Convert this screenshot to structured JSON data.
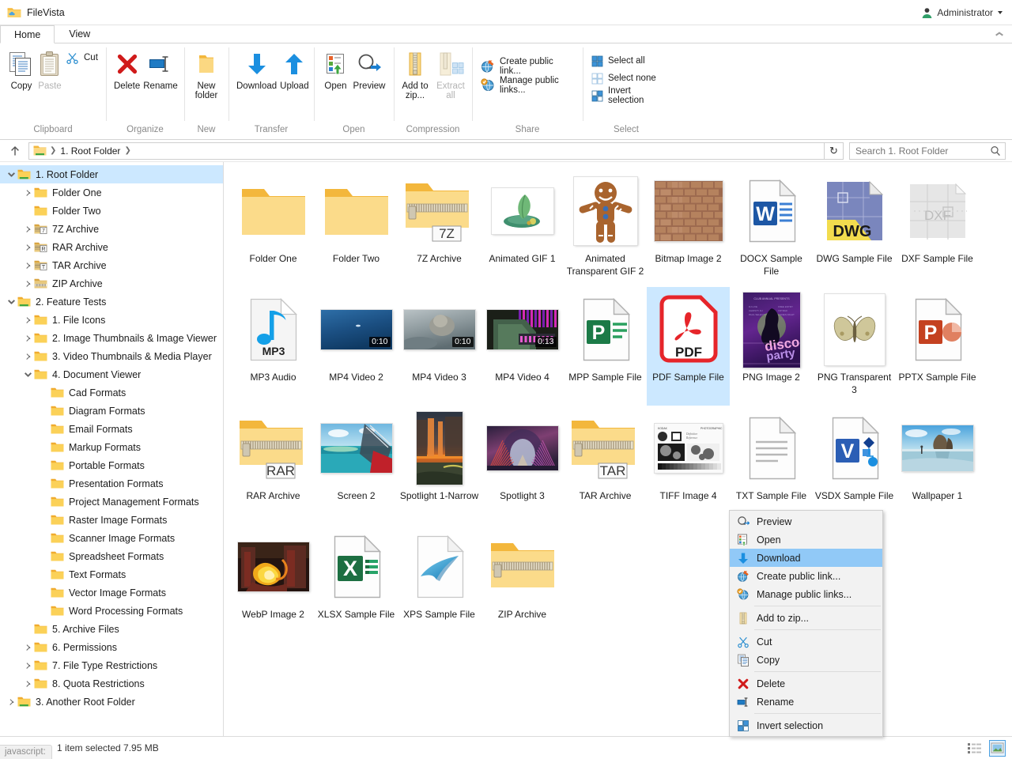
{
  "app": {
    "title": "FileVista",
    "user": "Administrator",
    "user_icon": "avatar-icon",
    "logo_icon": "folder-cloud-icon"
  },
  "tabs": [
    {
      "label": "Home",
      "active": true
    },
    {
      "label": "View",
      "active": false
    }
  ],
  "ribbon": {
    "collapse_icon": "chevron-up-icon",
    "groups": [
      {
        "label": "Clipboard",
        "big": [
          {
            "label": "Copy",
            "icon": "copy-icon",
            "disabled": false
          },
          {
            "label": "Paste",
            "icon": "paste-icon",
            "disabled": true
          }
        ],
        "small": [
          {
            "label": "Cut",
            "icon": "scissors-icon",
            "disabled": false
          }
        ]
      },
      {
        "label": "Organize",
        "big": [
          {
            "label": "Delete",
            "icon": "delete-x-icon",
            "disabled": false
          },
          {
            "label": "Rename",
            "icon": "rename-icon",
            "disabled": false
          }
        ],
        "small": []
      },
      {
        "label": "New",
        "big": [
          {
            "label": "New folder",
            "icon": "new-folder-icon",
            "disabled": false
          }
        ],
        "small": []
      },
      {
        "label": "Transfer",
        "big": [
          {
            "label": "Download",
            "icon": "download-arrow-icon",
            "disabled": false
          },
          {
            "label": "Upload",
            "icon": "upload-arrow-icon",
            "disabled": false
          }
        ],
        "small": []
      },
      {
        "label": "Open",
        "big": [
          {
            "label": "Open",
            "icon": "open-icon",
            "disabled": false
          },
          {
            "label": "Preview",
            "icon": "preview-magnifier-icon",
            "disabled": false
          }
        ],
        "small": []
      },
      {
        "label": "Compression",
        "big": [
          {
            "label": "Add to zip...",
            "icon": "zip-add-icon",
            "disabled": false
          },
          {
            "label": "Extract all",
            "icon": "zip-extract-icon",
            "disabled": true,
            "dropdown": true
          }
        ],
        "small": []
      },
      {
        "label": "Share",
        "big": [],
        "small": [
          {
            "label": "Create public link...",
            "icon": "globe-link-icon",
            "disabled": false
          },
          {
            "label": "Manage public links...",
            "icon": "globe-manage-icon",
            "disabled": false
          }
        ]
      },
      {
        "label": "Select",
        "big": [],
        "small": [
          {
            "label": "Select all",
            "icon": "select-all-icon",
            "disabled": false
          },
          {
            "label": "Select none",
            "icon": "select-none-icon",
            "disabled": false
          },
          {
            "label": "Invert selection",
            "icon": "invert-selection-icon",
            "disabled": false
          }
        ]
      }
    ]
  },
  "address": {
    "up_icon": "up-arrow-icon",
    "root_icon": "folder-root-icon",
    "crumbs": [
      "1. Root Folder"
    ],
    "refresh_icon": "refresh-icon",
    "search_placeholder": "Search 1. Root Folder",
    "search_value": "",
    "search_icon": "search-icon"
  },
  "tree": [
    {
      "label": "1. Root Folder",
      "depth": 0,
      "state": "open",
      "icon": "folder-root-icon",
      "selected": true
    },
    {
      "label": "Folder One",
      "depth": 1,
      "state": "closed",
      "icon": "folder-icon",
      "selected": false
    },
    {
      "label": "Folder Two",
      "depth": 1,
      "state": "leaf",
      "icon": "folder-icon",
      "selected": false
    },
    {
      "label": "7Z Archive",
      "depth": 1,
      "state": "closed",
      "icon": "folder-7z-icon",
      "selected": false
    },
    {
      "label": "RAR Archive",
      "depth": 1,
      "state": "closed",
      "icon": "folder-rar-icon",
      "selected": false
    },
    {
      "label": "TAR Archive",
      "depth": 1,
      "state": "closed",
      "icon": "folder-tar-icon",
      "selected": false
    },
    {
      "label": "ZIP Archive",
      "depth": 1,
      "state": "closed",
      "icon": "folder-zip-icon",
      "selected": false
    },
    {
      "label": "2. Feature Tests",
      "depth": 0,
      "state": "open",
      "icon": "folder-root-icon",
      "selected": false
    },
    {
      "label": "1. File Icons",
      "depth": 1,
      "state": "closed",
      "icon": "folder-icon",
      "selected": false
    },
    {
      "label": "2. Image Thumbnails & Image Viewer",
      "depth": 1,
      "state": "closed",
      "icon": "folder-icon",
      "selected": false
    },
    {
      "label": "3. Video Thumbnails & Media Player",
      "depth": 1,
      "state": "closed",
      "icon": "folder-icon",
      "selected": false
    },
    {
      "label": "4. Document Viewer",
      "depth": 1,
      "state": "open",
      "icon": "folder-icon",
      "selected": false
    },
    {
      "label": "Cad Formats",
      "depth": 2,
      "state": "leaf",
      "icon": "folder-icon",
      "selected": false
    },
    {
      "label": "Diagram Formats",
      "depth": 2,
      "state": "leaf",
      "icon": "folder-icon",
      "selected": false
    },
    {
      "label": "Email Formats",
      "depth": 2,
      "state": "leaf",
      "icon": "folder-icon",
      "selected": false
    },
    {
      "label": "Markup Formats",
      "depth": 2,
      "state": "leaf",
      "icon": "folder-icon",
      "selected": false
    },
    {
      "label": "Portable Formats",
      "depth": 2,
      "state": "leaf",
      "icon": "folder-icon",
      "selected": false
    },
    {
      "label": "Presentation Formats",
      "depth": 2,
      "state": "leaf",
      "icon": "folder-icon",
      "selected": false
    },
    {
      "label": "Project Management Formats",
      "depth": 2,
      "state": "leaf",
      "icon": "folder-icon",
      "selected": false
    },
    {
      "label": "Raster Image Formats",
      "depth": 2,
      "state": "leaf",
      "icon": "folder-icon",
      "selected": false
    },
    {
      "label": "Scanner Image Formats",
      "depth": 2,
      "state": "leaf",
      "icon": "folder-icon",
      "selected": false
    },
    {
      "label": "Spreadsheet Formats",
      "depth": 2,
      "state": "leaf",
      "icon": "folder-icon",
      "selected": false
    },
    {
      "label": "Text Formats",
      "depth": 2,
      "state": "leaf",
      "icon": "folder-icon",
      "selected": false
    },
    {
      "label": "Vector Image Formats",
      "depth": 2,
      "state": "leaf",
      "icon": "folder-icon",
      "selected": false
    },
    {
      "label": "Word Processing Formats",
      "depth": 2,
      "state": "leaf",
      "icon": "folder-icon",
      "selected": false
    },
    {
      "label": "5. Archive Files",
      "depth": 1,
      "state": "leaf",
      "icon": "folder-icon",
      "selected": false
    },
    {
      "label": "6. Permissions",
      "depth": 1,
      "state": "closed",
      "icon": "folder-icon",
      "selected": false
    },
    {
      "label": "7. File Type Restrictions",
      "depth": 1,
      "state": "closed",
      "icon": "folder-icon",
      "selected": false
    },
    {
      "label": "8. Quota Restrictions",
      "depth": 1,
      "state": "closed",
      "icon": "folder-icon",
      "selected": false
    },
    {
      "label": "3. Another Root Folder",
      "depth": 0,
      "state": "closed",
      "icon": "folder-root-icon",
      "selected": false
    }
  ],
  "files": [
    {
      "name": "Folder One",
      "icon": "folder-large-icon",
      "selected": false
    },
    {
      "name": "Folder Two",
      "icon": "folder-large-icon",
      "selected": false
    },
    {
      "name": "7Z Archive",
      "icon": "folder-archive-7z-icon",
      "badge": "7Z",
      "selected": false
    },
    {
      "name": "Animated GIF 1",
      "icon": "thumb-gif-leaf",
      "selected": false
    },
    {
      "name": "Animated Transparent GIF 2",
      "icon": "thumb-gingerbread",
      "selected": false
    },
    {
      "name": "Bitmap Image 2",
      "icon": "thumb-brick",
      "selected": false
    },
    {
      "name": "DOCX Sample File",
      "icon": "docx-icon",
      "selected": false
    },
    {
      "name": "DWG Sample File",
      "icon": "dwg-icon",
      "selected": false
    },
    {
      "name": "DXF Sample File",
      "icon": "dxf-icon",
      "selected": false
    },
    {
      "name": "MP3 Audio",
      "icon": "mp3-icon",
      "selected": false
    },
    {
      "name": "MP4 Video 2",
      "icon": "thumb-video-blue",
      "duration": "0:10",
      "selected": false
    },
    {
      "name": "MP4 Video 3",
      "icon": "thumb-video-otter",
      "duration": "0:10",
      "selected": false
    },
    {
      "name": "MP4 Video 4",
      "icon": "thumb-video-arcade",
      "duration": "0:13",
      "selected": false
    },
    {
      "name": "MPP Sample File",
      "icon": "mpp-icon",
      "selected": false
    },
    {
      "name": "PDF Sample File",
      "icon": "pdf-icon",
      "selected": true
    },
    {
      "name": "PNG Image 2",
      "icon": "thumb-disco-poster",
      "selected": false
    },
    {
      "name": "PNG Transparent 3",
      "icon": "thumb-butterfly",
      "selected": false
    },
    {
      "name": "PPTX Sample File",
      "icon": "pptx-icon",
      "selected": false
    },
    {
      "name": "RAR Archive",
      "icon": "folder-archive-rar-icon",
      "badge": "RAR",
      "selected": false
    },
    {
      "name": "Screen 2",
      "icon": "thumb-seaplane",
      "selected": false
    },
    {
      "name": "Spotlight 1-Narrow",
      "icon": "thumb-waterfall",
      "selected": false
    },
    {
      "name": "Spotlight 3",
      "icon": "thumb-bridge",
      "selected": false
    },
    {
      "name": "TAR Archive",
      "icon": "folder-archive-tar-icon",
      "badge": "TAR",
      "selected": false
    },
    {
      "name": "TIFF Image 4",
      "icon": "thumb-tiff-chart",
      "selected": false
    },
    {
      "name": "TXT Sample File",
      "icon": "txt-icon",
      "selected": false,
      "occluded": true
    },
    {
      "name": "VSDX Sample File",
      "icon": "vsdx-icon",
      "selected": false
    },
    {
      "name": "Wallpaper 1",
      "icon": "thumb-beach",
      "selected": false
    },
    {
      "name": "WebP Image 2",
      "icon": "thumb-fire",
      "selected": false
    },
    {
      "name": "XLSX Sample File",
      "icon": "xlsx-icon",
      "selected": false
    },
    {
      "name": "XPS Sample File",
      "icon": "xps-icon",
      "selected": false
    },
    {
      "name": "ZIP Archive",
      "icon": "folder-archive-zip-icon",
      "selected": false
    }
  ],
  "context_menu": {
    "items": [
      {
        "label": "Preview",
        "icon": "preview-magnifier-icon",
        "highlighted": false,
        "disabled": false
      },
      {
        "label": "Open",
        "icon": "open-icon",
        "highlighted": false,
        "disabled": false
      },
      {
        "label": "Download",
        "icon": "download-arrow-icon",
        "highlighted": true,
        "disabled": false
      },
      {
        "label": "Create public link...",
        "icon": "globe-link-icon",
        "highlighted": false,
        "disabled": false
      },
      {
        "label": "Manage public links...",
        "icon": "globe-manage-icon",
        "highlighted": false,
        "disabled": false
      },
      {
        "separator": true
      },
      {
        "label": "Add to zip...",
        "icon": "zip-add-icon",
        "highlighted": false,
        "disabled": false
      },
      {
        "separator": true
      },
      {
        "label": "Cut",
        "icon": "scissors-icon",
        "highlighted": false,
        "disabled": false
      },
      {
        "label": "Copy",
        "icon": "copy-icon",
        "highlighted": false,
        "disabled": false
      },
      {
        "separator": true
      },
      {
        "label": "Delete",
        "icon": "delete-x-icon",
        "highlighted": false,
        "disabled": false
      },
      {
        "label": "Rename",
        "icon": "rename-icon",
        "highlighted": false,
        "disabled": false
      },
      {
        "separator": true
      },
      {
        "label": "Invert selection",
        "icon": "invert-selection-icon",
        "highlighted": false,
        "disabled": false
      }
    ]
  },
  "statusbar": {
    "js_badge": "javascript:",
    "text": "1 item selected  7.95 MB",
    "views": [
      {
        "icon": "list-view-icon",
        "active": false
      },
      {
        "icon": "thumbnail-view-icon",
        "active": true
      }
    ]
  },
  "colors": {
    "selection": "#cce8ff",
    "menu_highlight": "#91c9f7",
    "folder": "#f9cc5b",
    "accent_blue": "#1a8ad4",
    "pdf_red": "#e6252a",
    "word_blue": "#1d57a5",
    "excel_green": "#1d6f42",
    "ppt_orange": "#c44120"
  }
}
